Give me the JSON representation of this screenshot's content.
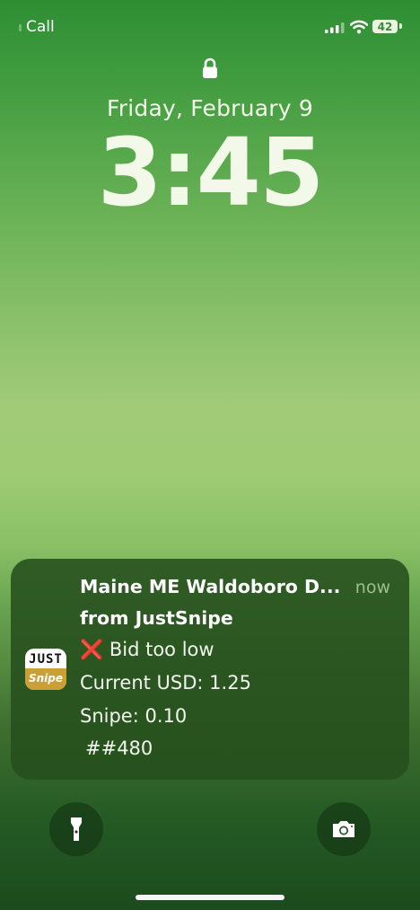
{
  "status_bar": {
    "carrier": "Call",
    "battery": "42"
  },
  "lock_screen": {
    "date": "Friday, February 9",
    "time": "3:45"
  },
  "notification": {
    "title": "Maine ME Waldoboro D...",
    "subtitle": "from JustSnipe",
    "time": "now",
    "icon_top": "JUST",
    "icon_bottom": "Snipe",
    "status_mark": "❌",
    "status_text": "Bid too low",
    "current_line": "Current USD: 1.25",
    "snipe_line": "Snipe: 0.10",
    "id_line": "##480"
  },
  "icons": {
    "lock": "lock-icon",
    "flashlight": "flashlight-icon",
    "camera": "camera-icon",
    "signal": "cellular-signal-icon",
    "wifi": "wifi-icon"
  },
  "colors": {
    "notification_bg": "#264e1c",
    "status_mark": "#e53a2c",
    "app_icon_accent": "#c99f36"
  }
}
